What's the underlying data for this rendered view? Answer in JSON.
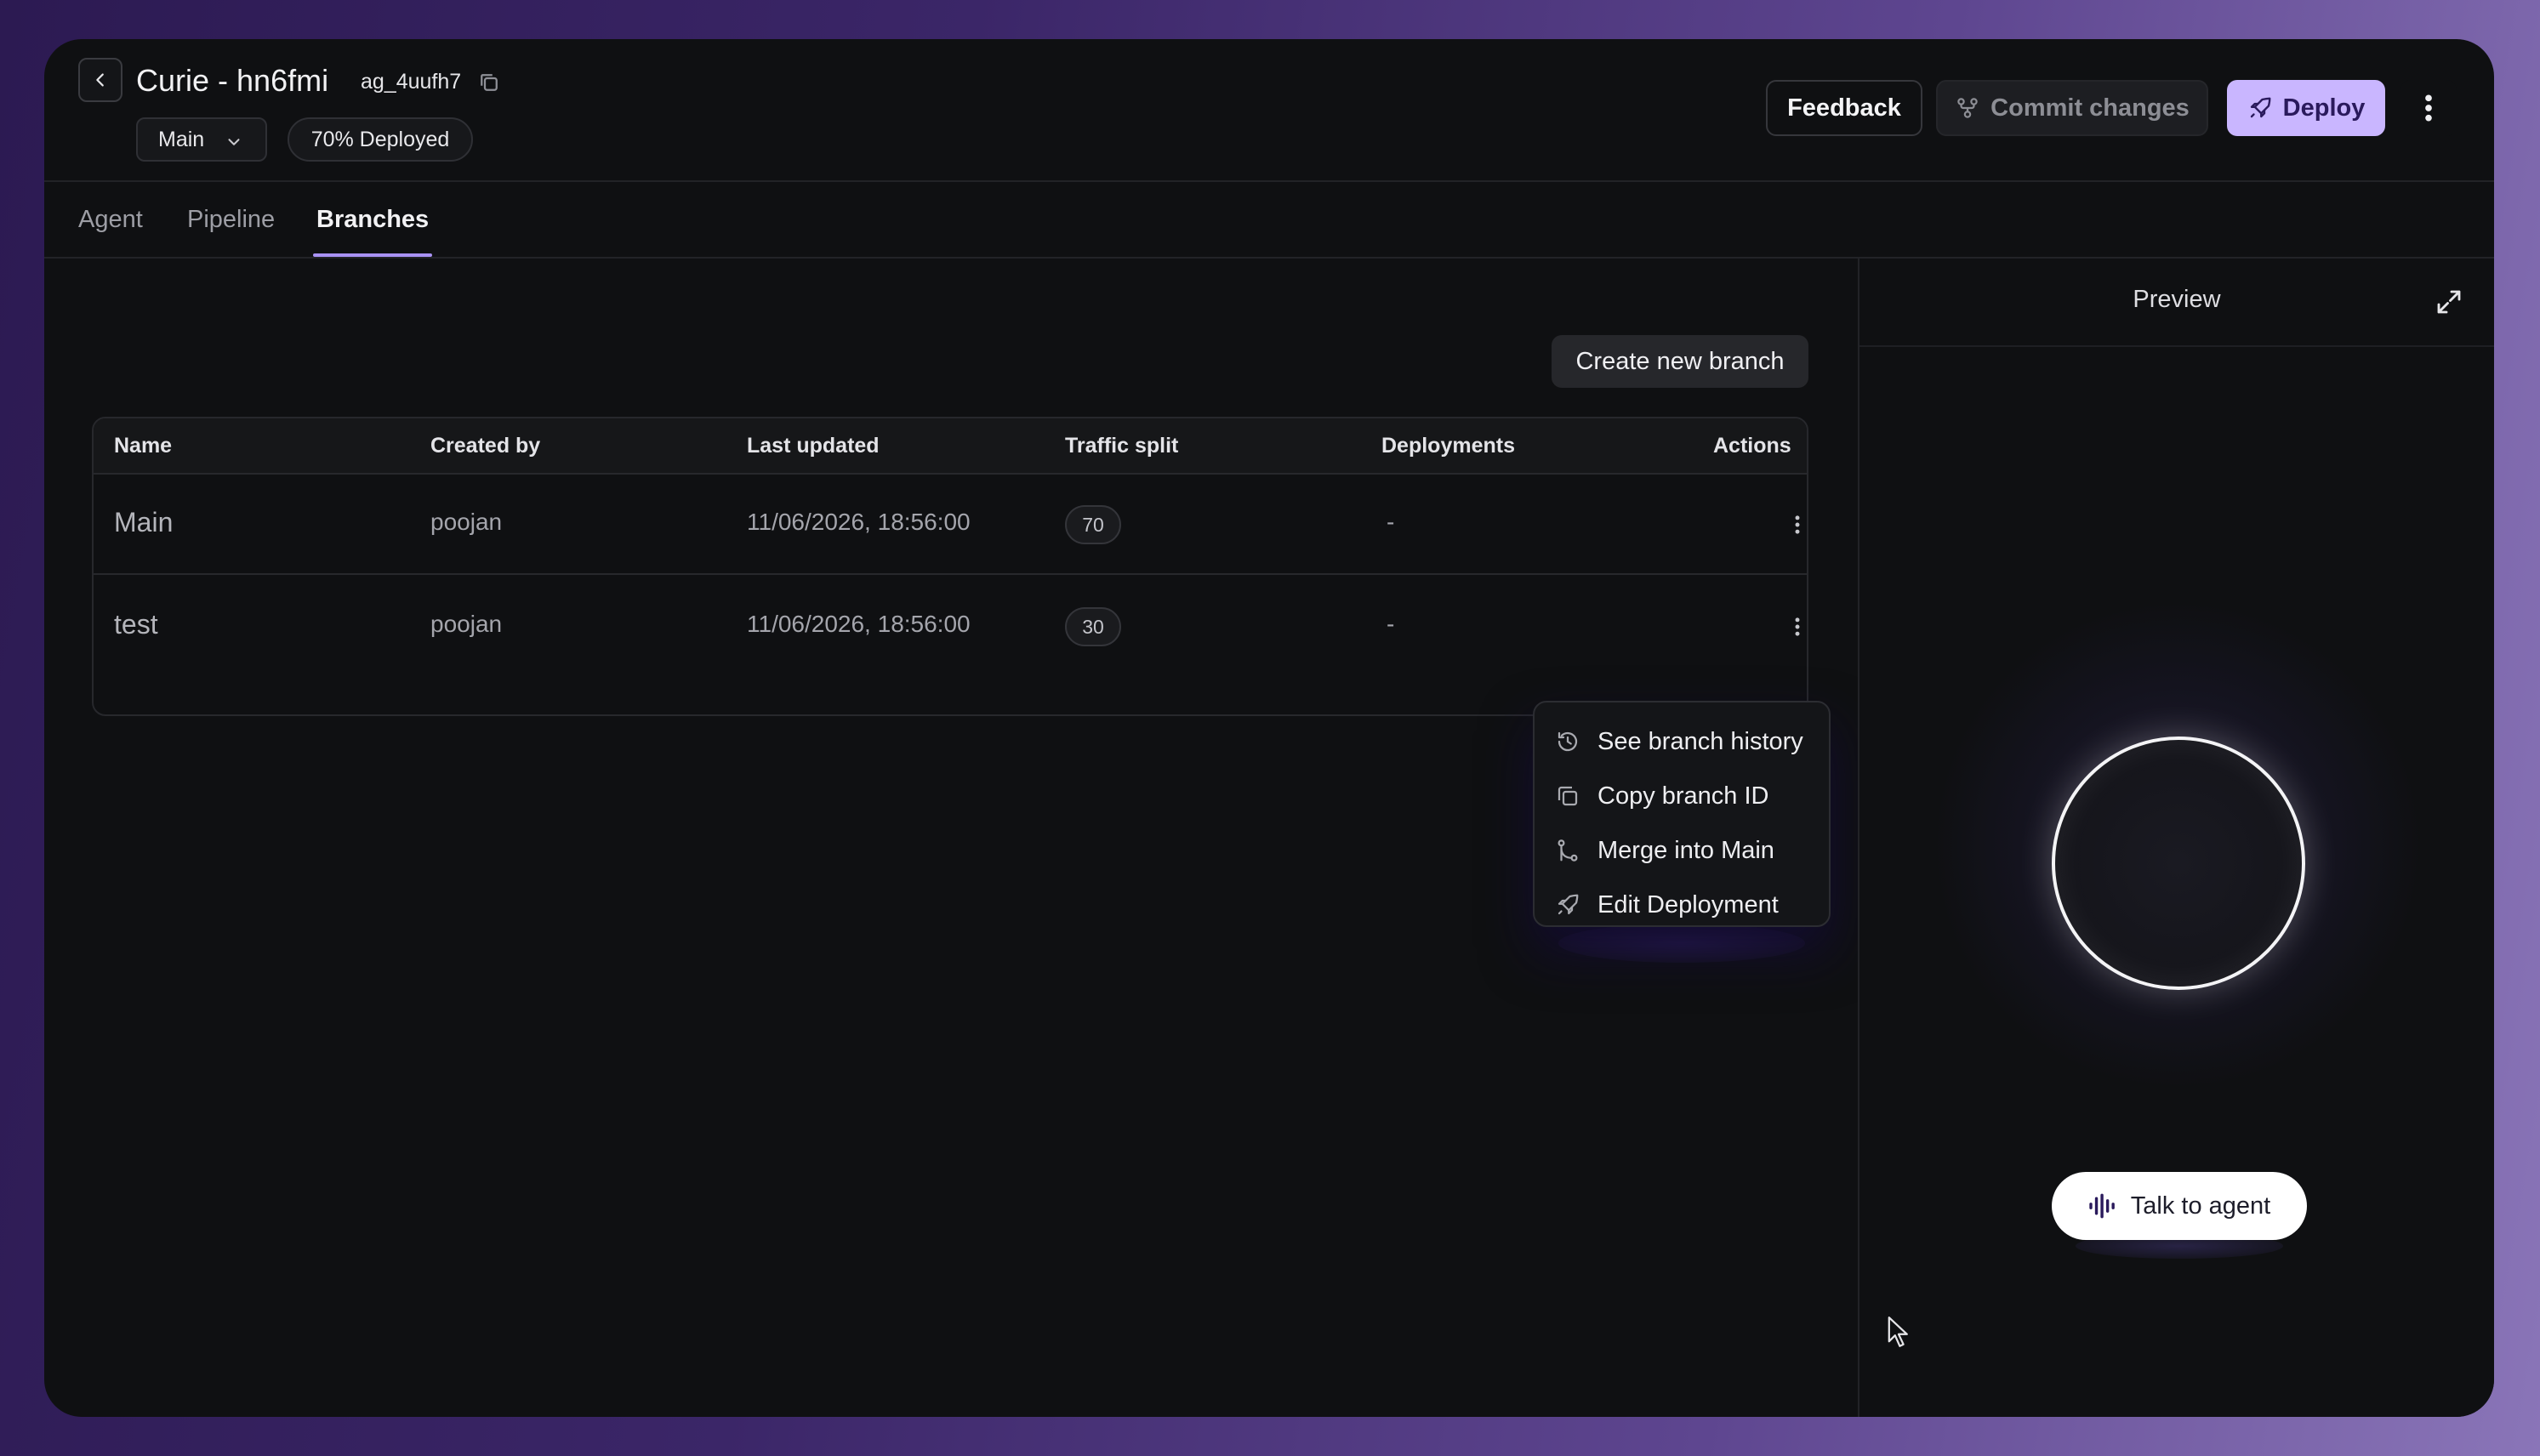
{
  "header": {
    "title": "Curie - hn6fmi",
    "agent_id": "ag_4uufh7",
    "branch": "Main",
    "deploy_status": "70% Deployed",
    "feedback_label": "Feedback",
    "commit_label": "Commit changes",
    "deploy_label": "Deploy"
  },
  "tabs": [
    {
      "label": "Agent"
    },
    {
      "label": "Pipeline"
    },
    {
      "label": "Branches"
    }
  ],
  "main": {
    "create_label": "Create new branch",
    "table": {
      "headers": [
        "Name",
        "Created by",
        "Last updated",
        "Traffic split",
        "Deployments",
        "Actions"
      ],
      "rows": [
        {
          "name": "Main",
          "created_by": "poojan",
          "last_updated": "11/06/2026, 18:56:00",
          "traffic": "70",
          "deployments": "-"
        },
        {
          "name": "test",
          "created_by": "poojan",
          "last_updated": "11/06/2026, 18:56:00",
          "traffic": "30",
          "deployments": "-"
        }
      ]
    },
    "menu": [
      {
        "label": "See branch history",
        "icon": "history-icon"
      },
      {
        "label": "Copy branch ID",
        "icon": "copy-icon"
      },
      {
        "label": "Merge into Main",
        "icon": "merge-icon"
      },
      {
        "label": "Edit Deployment",
        "icon": "rocket-icon"
      }
    ]
  },
  "preview": {
    "title": "Preview",
    "talk_label": "Talk to agent"
  },
  "colors": {
    "accent": "#a992f4",
    "deploy_bg": "#c9b6ff",
    "background": "#0f1012"
  }
}
